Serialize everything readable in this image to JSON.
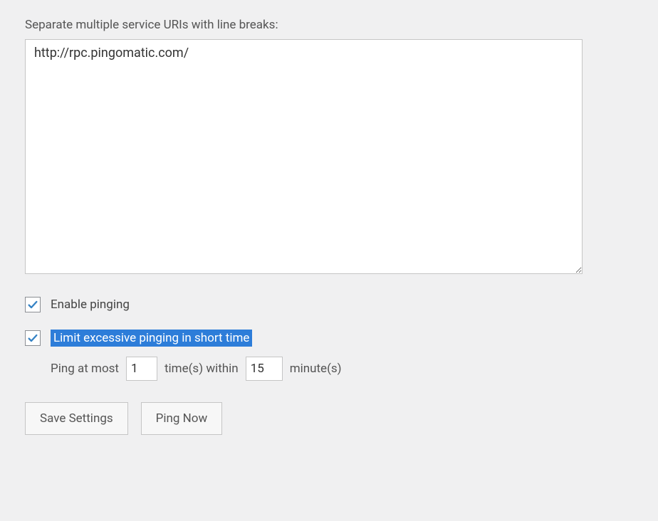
{
  "uris": {
    "label": "Separate multiple service URIs with line breaks:",
    "value": "http://rpc.pingomatic.com/"
  },
  "checkboxes": {
    "enable": {
      "label": "Enable pinging",
      "checked": true
    },
    "limit": {
      "label": "Limit excessive pinging in short time",
      "checked": true
    }
  },
  "limits": {
    "prefix": "Ping at most",
    "times_value": "1",
    "mid": "time(s) within",
    "minutes_value": "15",
    "suffix": "minute(s)"
  },
  "buttons": {
    "save": "Save Settings",
    "ping_now": "Ping Now"
  },
  "colors": {
    "highlight_bg": "#2d7dd9",
    "check_stroke": "#3582c4"
  }
}
